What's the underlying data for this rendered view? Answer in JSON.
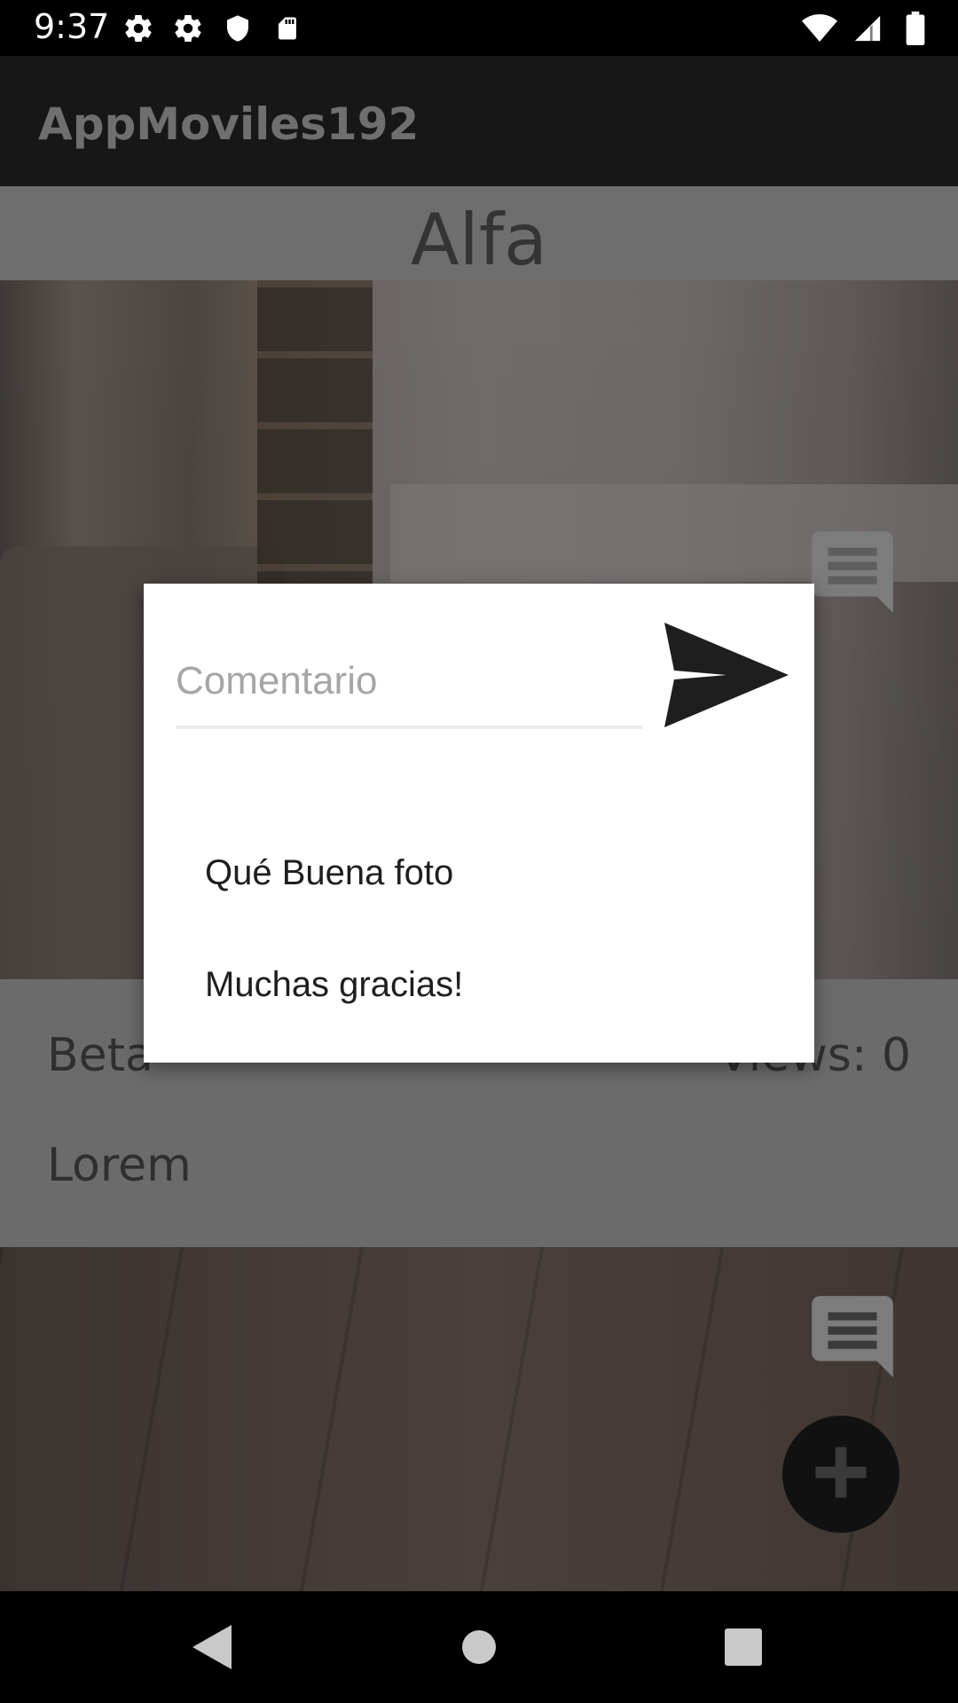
{
  "status_bar": {
    "time": "9:37",
    "left_icons": [
      "settings-icon",
      "settings-icon",
      "shield-icon",
      "sd-card-icon"
    ],
    "right_icons": [
      "wifi-icon",
      "signal-icon",
      "battery-icon"
    ]
  },
  "app_bar": {
    "title": "AppMoviles192"
  },
  "card1": {
    "title": "Alfa",
    "author": "Beta",
    "views": "Views: 0",
    "description": "Lorem"
  },
  "dialog": {
    "input_placeholder": "Comentario",
    "input_value": "",
    "send_icon": "send-icon",
    "comments": [
      "Qué Buena foto",
      "Muchas gracias!"
    ]
  },
  "fab": {
    "icon": "add-icon"
  },
  "nav_bar": {
    "icons": [
      "back-icon",
      "home-icon",
      "recents-icon"
    ]
  },
  "colors": {
    "scrim": "#000000",
    "dialog_bg": "#ffffff",
    "app_bar": "#171717",
    "placeholder": "#a6a6a6"
  }
}
